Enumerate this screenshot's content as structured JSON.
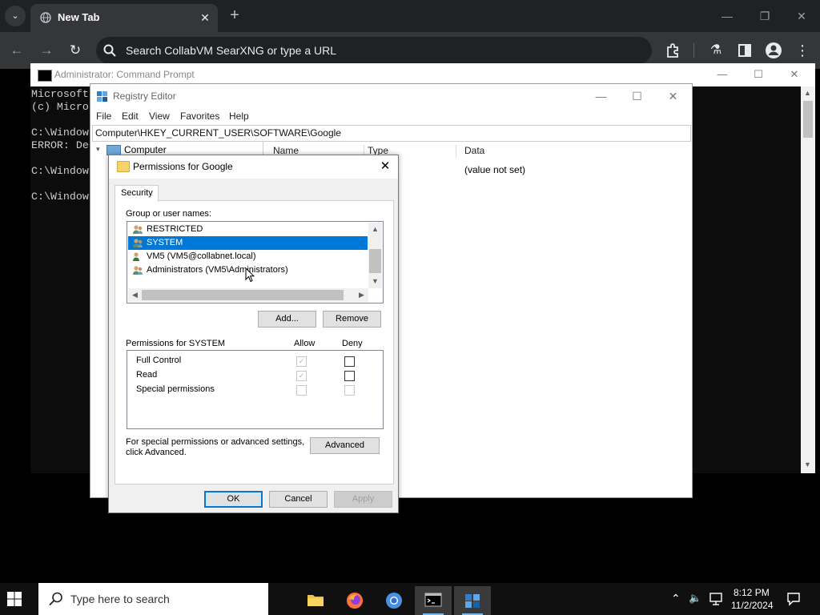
{
  "browser": {
    "tab_title": "New Tab",
    "tab_close": "✕",
    "new_tab": "+",
    "tab_search": "⌄",
    "omnibox_placeholder": "Search CollabVM SearXNG or type a URL",
    "window_controls": {
      "minimize": "—",
      "restore": "❐",
      "close": "✕"
    },
    "nav": {
      "back": "←",
      "forward": "→",
      "reload": "↻"
    },
    "toolbar_icons": [
      "puzzle-icon",
      "labs-flask-icon",
      "side-panel-icon",
      "profile-icon",
      "menu-kebab-icon"
    ],
    "toolbar_glyphs": {
      "labs": "⚗",
      "menu": "⋮"
    }
  },
  "cmd": {
    "title": "Administrator: Command Prompt",
    "controls": {
      "minimize": "—",
      "maximize": "☐",
      "close": "✕"
    },
    "lines": [
      "Microsoft",
      "(c) Micro",
      "",
      "C:\\Window",
      "ERROR: De",
      "",
      "C:\\Window",
      "",
      "C:\\Window"
    ]
  },
  "regedit": {
    "title": "Registry Editor",
    "controls": {
      "minimize": "—",
      "maximize": "☐",
      "close": "✕"
    },
    "menu": [
      "File",
      "Edit",
      "View",
      "Favorites",
      "Help"
    ],
    "address": "Computer\\HKEY_CURRENT_USER\\SOFTWARE\\Google",
    "tree": {
      "expander": "▾",
      "root": "Computer"
    },
    "columns": [
      "Name",
      "Type",
      "Data"
    ],
    "value_data": "(value not set)"
  },
  "perm": {
    "title": "Permissions for Google",
    "close": "✕",
    "tab": "Security",
    "group_label": "Group or user names:",
    "groups": [
      {
        "name": "RESTRICTED",
        "selected": false
      },
      {
        "name": "SYSTEM",
        "selected": true
      },
      {
        "name": "VM5 (VM5@collabnet.local)",
        "selected": false
      },
      {
        "name": "Administrators (VM5\\Administrators)",
        "selected": false
      }
    ],
    "scroll_arrows": {
      "up": "▲",
      "down": "▼",
      "left": "◀",
      "right": "▶"
    },
    "add_btn": "Add...",
    "remove_btn": "Remove",
    "permissions_for": "Permissions for SYSTEM",
    "allow": "Allow",
    "deny": "Deny",
    "permissions": [
      {
        "name": "Full Control",
        "allow": true,
        "allow_disabled": true,
        "deny": false,
        "deny_disabled": false
      },
      {
        "name": "Read",
        "allow": true,
        "allow_disabled": true,
        "deny": false,
        "deny_disabled": false
      },
      {
        "name": "Special permissions",
        "allow": false,
        "allow_disabled": true,
        "deny": false,
        "deny_disabled": true
      }
    ],
    "checkmark": "✓",
    "advanced_text_1": "For special permissions or advanced settings,",
    "advanced_text_2": "click Advanced.",
    "advanced_btn": "Advanced",
    "ok_btn": "OK",
    "cancel_btn": "Cancel",
    "apply_btn": "Apply"
  },
  "taskbar": {
    "search_placeholder": "Type here to search",
    "apps": [
      "file-explorer-icon",
      "firefox-icon",
      "chromium-icon",
      "command-prompt-icon",
      "registry-editor-icon"
    ],
    "tray": {
      "chevron": "⌃",
      "volume": "🔈",
      "network": "network-icon",
      "notifications": "notification-icon"
    },
    "time": "8:12 PM",
    "date": "11/2/2024"
  },
  "colors": {
    "accent": "#0078d7",
    "browser_dark": "#202124",
    "browser_mid": "#35363a",
    "taskbar": "#101010"
  }
}
